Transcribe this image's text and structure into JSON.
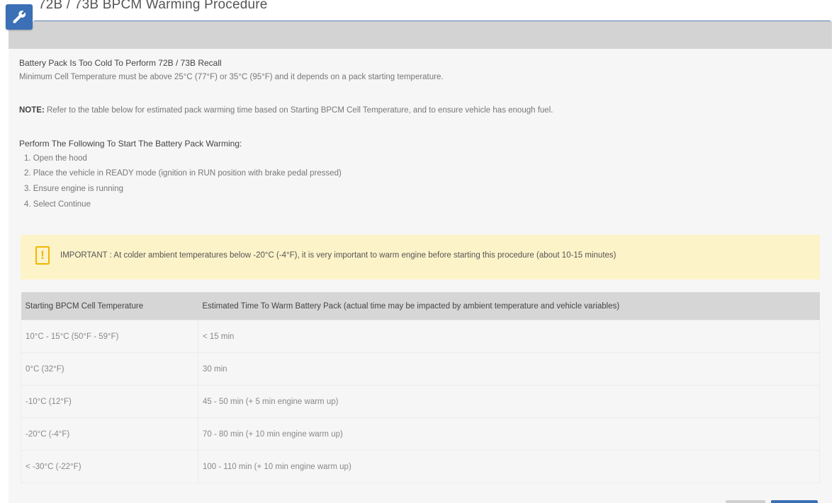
{
  "window": {
    "title": "72B / 73B BPCM Warming Procedure",
    "icon": "wrench-icon",
    "accent_color": "#3b6fb6"
  },
  "content": {
    "heading": "Battery Pack Is Too Cold To Perform 72B / 73B Recall",
    "min_temp_text": "Minimum Cell Temperature must be above 25°C (77°F) or 35°C (95°F) and it depends on a pack starting temperature.",
    "note_label": "NOTE:",
    "note_text": "Refer to the table below for estimated pack warming time based on Starting BPCM Cell Temperature, and to ensure vehicle has enough fuel.",
    "steps_heading": "Perform The Following To Start The Battery Pack Warming:",
    "steps": [
      "1. Open the hood",
      "2. Place the vehicle in READY mode (ignition in RUN position with brake pedal pressed)",
      "3. Ensure engine is running",
      "4. Select Continue"
    ]
  },
  "callout": {
    "icon": "warning-icon",
    "text": "IMPORTANT : At colder ambient temperatures below -20°C (-4°F), it is very important to warm engine before starting this procedure (about 10-15 minutes)",
    "bg_color": "#fdf3c9",
    "icon_color": "#f2b600"
  },
  "table": {
    "headers": [
      "Starting BPCM Cell Temperature",
      "Estimated Time To Warm Battery Pack (actual time may be impacted by ambient temperature and vehicle variables)"
    ],
    "rows": [
      [
        "10°C - 15°C (50°F - 59°F)",
        "< 15 min"
      ],
      [
        "0°C (32°F)",
        "30 min"
      ],
      [
        "-10°C (12°F)",
        "45 - 50 min (+ 5 min engine warm up)"
      ],
      [
        "-20°C (-4°F)",
        "70 - 80 min (+ 10 min engine warm up)"
      ],
      [
        "< -30°C (-22°F)",
        "100 - 110 min (+ 10 min engine warm up)"
      ]
    ]
  }
}
